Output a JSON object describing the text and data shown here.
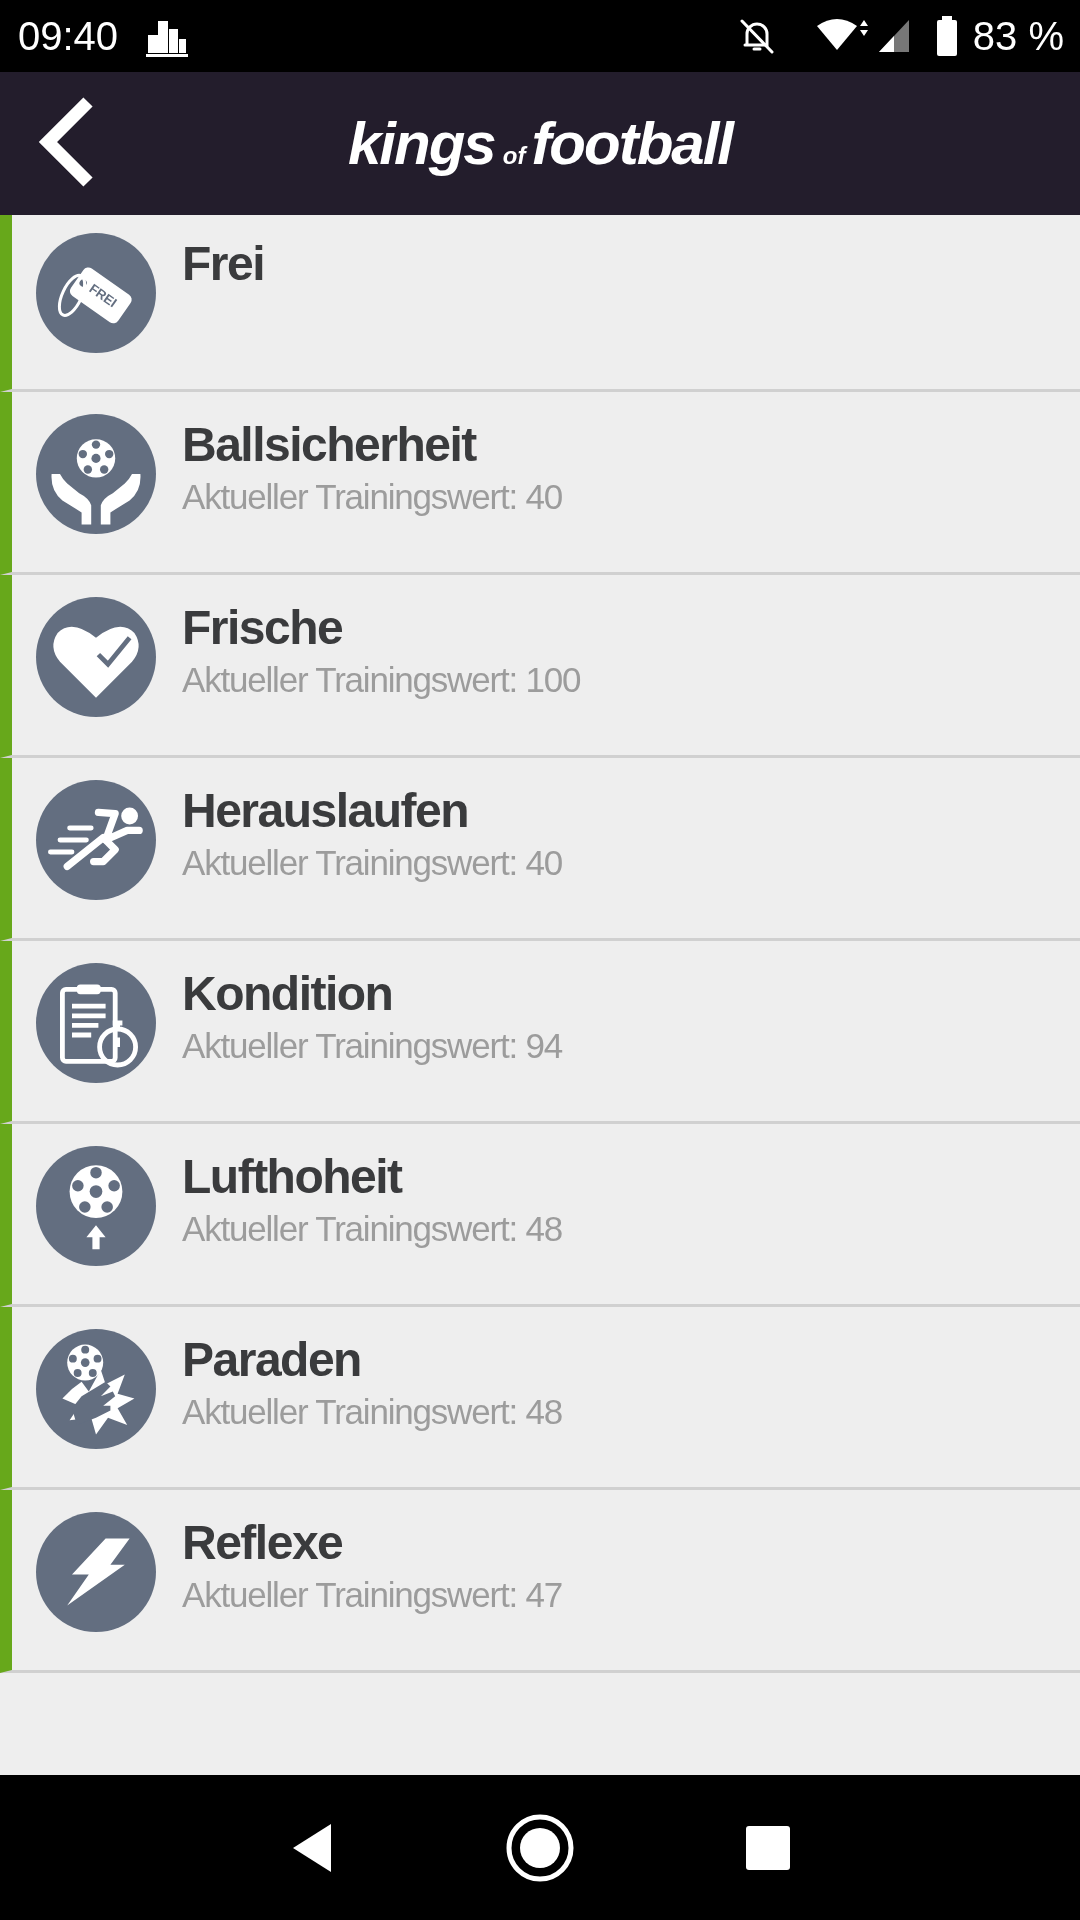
{
  "status_bar": {
    "time": "09:40",
    "battery": "83 %"
  },
  "header": {
    "logo_main": "kings",
    "logo_small": "of",
    "logo_end": "football"
  },
  "items": [
    {
      "kind": "tag",
      "title": "Frei",
      "icon_text": "FREI"
    },
    {
      "kind": "hands-ball",
      "title": "Ballsicherheit",
      "subtitle": "Aktueller Trainingswert: 40"
    },
    {
      "kind": "heart",
      "title": "Frische",
      "subtitle": "Aktueller Trainingswert: 100"
    },
    {
      "kind": "runner",
      "title": "Herauslaufen",
      "subtitle": "Aktueller Trainingswert: 40"
    },
    {
      "kind": "clipboard",
      "title": "Kondition",
      "subtitle": "Aktueller Trainingswert: 94"
    },
    {
      "kind": "ball-arrow",
      "title": "Lufthoheit",
      "subtitle": "Aktueller Trainingswert: 48"
    },
    {
      "kind": "hand-ball",
      "title": "Paraden",
      "subtitle": "Aktueller Trainingswert: 48"
    },
    {
      "kind": "bolt",
      "title": "Reflexe",
      "subtitle": "Aktueller Trainingswert: 47"
    }
  ]
}
